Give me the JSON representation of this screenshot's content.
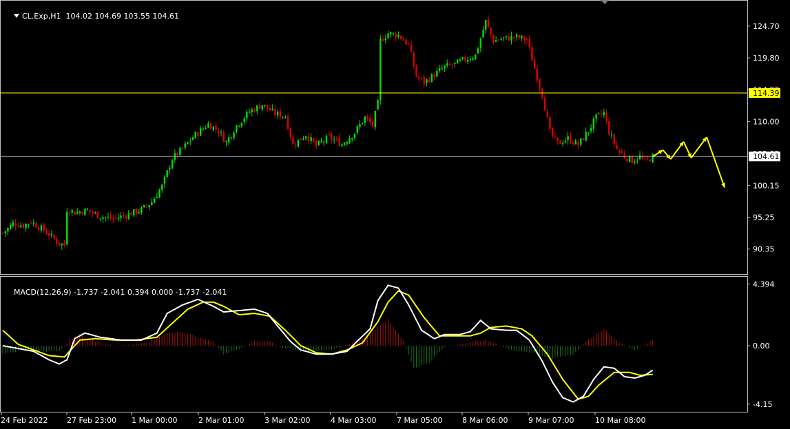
{
  "header": {
    "symbol": "CL.Exp,H1",
    "ohlc": "104.02 104.69 103.55 104.61"
  },
  "macd_header": {
    "label": "MACD(12,26,9) -1.737 -2.041 0.394 0.000 -1.737 -2.041"
  },
  "colors": {
    "background": "#000000",
    "bull": "#00e000",
    "bear": "#e00000",
    "line_yellow": "#ffff00",
    "line_white": "#ffffff",
    "hist_pos": "#b01010",
    "hist_neg": "#1f6e1f",
    "grid_line": "#808080"
  },
  "chart_data": [
    {
      "type": "candlestick",
      "symbol": "CL.Exp",
      "timeframe": "H1",
      "y_ticks": [
        "124.70",
        "119.80",
        "114.90",
        "110.00",
        "105.05",
        "100.15",
        "95.25",
        "90.35"
      ],
      "ylim": [
        86.5,
        128.5
      ],
      "horizontal_lines": [
        {
          "value": 114.39,
          "label": "114.39",
          "color": "#ffff00"
        },
        {
          "value": 104.61,
          "label": "104.61",
          "color": "#a0a0a0"
        }
      ],
      "price_anchors": [
        {
          "t": 0,
          "p": 92.8
        },
        {
          "t": 2,
          "p": 93.5
        },
        {
          "t": 4,
          "p": 94.3
        },
        {
          "t": 8,
          "p": 94.0
        },
        {
          "t": 11,
          "p": 94.6
        },
        {
          "t": 14,
          "p": 93.8
        },
        {
          "t": 18,
          "p": 92.6
        },
        {
          "t": 22,
          "p": 91.2
        },
        {
          "t": 24,
          "p": 91.0
        },
        {
          "t": 25,
          "p": 96.5
        },
        {
          "t": 28,
          "p": 96.0
        },
        {
          "t": 33,
          "p": 96.3
        },
        {
          "t": 38,
          "p": 95.4
        },
        {
          "t": 43,
          "p": 95.0
        },
        {
          "t": 48,
          "p": 95.6
        },
        {
          "t": 54,
          "p": 96.4
        },
        {
          "t": 58,
          "p": 97.6
        },
        {
          "t": 62,
          "p": 100.0
        },
        {
          "t": 66,
          "p": 104.3
        },
        {
          "t": 70,
          "p": 105.8
        },
        {
          "t": 74,
          "p": 107.6
        },
        {
          "t": 80,
          "p": 109.6
        },
        {
          "t": 84,
          "p": 108.6
        },
        {
          "t": 87,
          "p": 106.8
        },
        {
          "t": 91,
          "p": 109.4
        },
        {
          "t": 96,
          "p": 111.5
        },
        {
          "t": 101,
          "p": 112.6
        },
        {
          "t": 106,
          "p": 111.2
        },
        {
          "t": 110,
          "p": 110.8
        },
        {
          "t": 113,
          "p": 106.4
        },
        {
          "t": 118,
          "p": 108.0
        },
        {
          "t": 122,
          "p": 106.2
        },
        {
          "t": 127,
          "p": 107.6
        },
        {
          "t": 132,
          "p": 106.5
        },
        {
          "t": 137,
          "p": 108.3
        },
        {
          "t": 141,
          "p": 110.6
        },
        {
          "t": 144,
          "p": 109.4
        },
        {
          "t": 146,
          "p": 112.8
        },
        {
          "t": 147,
          "p": 122.5
        },
        {
          "t": 150,
          "p": 123.6
        },
        {
          "t": 154,
          "p": 123.3
        },
        {
          "t": 158,
          "p": 121.8
        },
        {
          "t": 161,
          "p": 117.0
        },
        {
          "t": 164,
          "p": 116.0
        },
        {
          "t": 168,
          "p": 117.2
        },
        {
          "t": 172,
          "p": 118.4
        },
        {
          "t": 176,
          "p": 118.8
        },
        {
          "t": 180,
          "p": 119.6
        },
        {
          "t": 184,
          "p": 120.2
        },
        {
          "t": 188,
          "p": 125.4
        },
        {
          "t": 191,
          "p": 122.4
        },
        {
          "t": 195,
          "p": 122.8
        },
        {
          "t": 200,
          "p": 123.0
        },
        {
          "t": 204,
          "p": 122.6
        },
        {
          "t": 207,
          "p": 118.2
        },
        {
          "t": 210,
          "p": 114.2
        },
        {
          "t": 213,
          "p": 108.3
        },
        {
          "t": 216,
          "p": 106.6
        },
        {
          "t": 220,
          "p": 107.4
        },
        {
          "t": 224,
          "p": 106.4
        },
        {
          "t": 228,
          "p": 108.6
        },
        {
          "t": 231,
          "p": 110.6
        },
        {
          "t": 234,
          "p": 111.3
        },
        {
          "t": 236,
          "p": 108.4
        },
        {
          "t": 239,
          "p": 105.8
        },
        {
          "t": 242,
          "p": 104.6
        },
        {
          "t": 245,
          "p": 104.0
        },
        {
          "t": 248,
          "p": 104.6
        },
        {
          "t": 250,
          "p": 103.8
        },
        {
          "t": 253,
          "p": 104.6
        }
      ],
      "projection": [
        {
          "t": 253,
          "p": 104.6
        },
        {
          "t": 257,
          "p": 105.6
        },
        {
          "t": 260,
          "p": 104.2
        },
        {
          "t": 265,
          "p": 106.9
        },
        {
          "t": 268,
          "p": 104.4
        },
        {
          "t": 274,
          "p": 107.6
        },
        {
          "t": 281,
          "p": 99.8
        }
      ]
    },
    {
      "type": "macd",
      "params": "12,26,9",
      "values": [
        -1.737,
        -2.041,
        0.394,
        0.0,
        -1.737,
        -2.041
      ],
      "y_ticks": [
        "4.394",
        "0.00",
        "-4.15"
      ],
      "ylim": [
        -4.7,
        4.9
      ],
      "x_ticks": [
        "24 Feb 2022",
        "27 Feb 23:00",
        "1 Mar 00:00",
        "2 Mar 01:00",
        "3 Mar 02:00",
        "4 Mar 03:00",
        "7 Mar 05:00",
        "8 Mar 06:00",
        "9 Mar 07:00",
        "10 Mar 08:00"
      ],
      "macd_line": [
        {
          "t": 0,
          "v": 0.0
        },
        {
          "t": 6,
          "v": -0.2
        },
        {
          "t": 12,
          "v": -0.4
        },
        {
          "t": 18,
          "v": -1.0
        },
        {
          "t": 22,
          "v": -1.3
        },
        {
          "t": 25,
          "v": -1.0
        },
        {
          "t": 28,
          "v": 0.5
        },
        {
          "t": 32,
          "v": 0.9
        },
        {
          "t": 38,
          "v": 0.6
        },
        {
          "t": 46,
          "v": 0.4
        },
        {
          "t": 54,
          "v": 0.4
        },
        {
          "t": 60,
          "v": 0.9
        },
        {
          "t": 64,
          "v": 2.3
        },
        {
          "t": 70,
          "v": 2.9
        },
        {
          "t": 76,
          "v": 3.3
        },
        {
          "t": 82,
          "v": 2.8
        },
        {
          "t": 86,
          "v": 2.4
        },
        {
          "t": 92,
          "v": 2.5
        },
        {
          "t": 98,
          "v": 2.6
        },
        {
          "t": 103,
          "v": 2.3
        },
        {
          "t": 107,
          "v": 1.4
        },
        {
          "t": 112,
          "v": 0.3
        },
        {
          "t": 116,
          "v": -0.3
        },
        {
          "t": 122,
          "v": -0.6
        },
        {
          "t": 128,
          "v": -0.6
        },
        {
          "t": 134,
          "v": -0.4
        },
        {
          "t": 139,
          "v": 0.5
        },
        {
          "t": 143,
          "v": 1.2
        },
        {
          "t": 146,
          "v": 3.2
        },
        {
          "t": 150,
          "v": 4.3
        },
        {
          "t": 154,
          "v": 4.1
        },
        {
          "t": 158,
          "v": 2.9
        },
        {
          "t": 163,
          "v": 1.1
        },
        {
          "t": 168,
          "v": 0.5
        },
        {
          "t": 172,
          "v": 0.8
        },
        {
          "t": 178,
          "v": 0.8
        },
        {
          "t": 182,
          "v": 1.0
        },
        {
          "t": 186,
          "v": 1.8
        },
        {
          "t": 190,
          "v": 1.2
        },
        {
          "t": 196,
          "v": 1.1
        },
        {
          "t": 200,
          "v": 1.1
        },
        {
          "t": 205,
          "v": 0.4
        },
        {
          "t": 210,
          "v": -1.1
        },
        {
          "t": 214,
          "v": -2.6
        },
        {
          "t": 218,
          "v": -3.7
        },
        {
          "t": 222,
          "v": -4.0
        },
        {
          "t": 226,
          "v": -3.6
        },
        {
          "t": 230,
          "v": -2.4
        },
        {
          "t": 234,
          "v": -1.5
        },
        {
          "t": 238,
          "v": -1.6
        },
        {
          "t": 242,
          "v": -2.2
        },
        {
          "t": 246,
          "v": -2.3
        },
        {
          "t": 250,
          "v": -2.1
        },
        {
          "t": 253,
          "v": -1.74
        }
      ],
      "signal_line": [
        {
          "t": 0,
          "v": 1.1
        },
        {
          "t": 6,
          "v": 0.1
        },
        {
          "t": 12,
          "v": -0.3
        },
        {
          "t": 18,
          "v": -0.7
        },
        {
          "t": 24,
          "v": -0.8
        },
        {
          "t": 30,
          "v": 0.4
        },
        {
          "t": 36,
          "v": 0.5
        },
        {
          "t": 44,
          "v": 0.4
        },
        {
          "t": 52,
          "v": 0.4
        },
        {
          "t": 60,
          "v": 0.6
        },
        {
          "t": 66,
          "v": 1.6
        },
        {
          "t": 72,
          "v": 2.6
        },
        {
          "t": 78,
          "v": 3.1
        },
        {
          "t": 82,
          "v": 3.1
        },
        {
          "t": 86,
          "v": 2.8
        },
        {
          "t": 92,
          "v": 2.2
        },
        {
          "t": 98,
          "v": 2.3
        },
        {
          "t": 104,
          "v": 2.1
        },
        {
          "t": 110,
          "v": 1.1
        },
        {
          "t": 116,
          "v": 0.0
        },
        {
          "t": 122,
          "v": -0.5
        },
        {
          "t": 128,
          "v": -0.6
        },
        {
          "t": 134,
          "v": -0.3
        },
        {
          "t": 140,
          "v": 0.2
        },
        {
          "t": 146,
          "v": 1.7
        },
        {
          "t": 150,
          "v": 3.1
        },
        {
          "t": 154,
          "v": 3.9
        },
        {
          "t": 158,
          "v": 3.6
        },
        {
          "t": 164,
          "v": 2.0
        },
        {
          "t": 170,
          "v": 0.7
        },
        {
          "t": 176,
          "v": 0.7
        },
        {
          "t": 182,
          "v": 0.7
        },
        {
          "t": 186,
          "v": 0.9
        },
        {
          "t": 190,
          "v": 1.3
        },
        {
          "t": 196,
          "v": 1.4
        },
        {
          "t": 202,
          "v": 1.2
        },
        {
          "t": 206,
          "v": 0.7
        },
        {
          "t": 212,
          "v": -0.6
        },
        {
          "t": 218,
          "v": -2.4
        },
        {
          "t": 224,
          "v": -3.8
        },
        {
          "t": 228,
          "v": -3.6
        },
        {
          "t": 232,
          "v": -2.8
        },
        {
          "t": 238,
          "v": -1.9
        },
        {
          "t": 244,
          "v": -1.9
        },
        {
          "t": 248,
          "v": -2.1
        },
        {
          "t": 253,
          "v": -2.04
        }
      ],
      "histogram": [
        {
          "t": 0,
          "v": -0.6
        },
        {
          "t": 8,
          "v": -0.3
        },
        {
          "t": 16,
          "v": -0.4
        },
        {
          "t": 22,
          "v": -0.4
        },
        {
          "t": 26,
          "v": 0.4
        },
        {
          "t": 30,
          "v": 0.8
        },
        {
          "t": 36,
          "v": 0.3
        },
        {
          "t": 44,
          "v": 0.0
        },
        {
          "t": 56,
          "v": 0.2
        },
        {
          "t": 64,
          "v": 0.9
        },
        {
          "t": 70,
          "v": 1.0
        },
        {
          "t": 76,
          "v": 0.6
        },
        {
          "t": 82,
          "v": 0.3
        },
        {
          "t": 86,
          "v": -0.6
        },
        {
          "t": 92,
          "v": -0.2
        },
        {
          "t": 98,
          "v": 0.3
        },
        {
          "t": 104,
          "v": 0.3
        },
        {
          "t": 108,
          "v": -0.1
        },
        {
          "t": 116,
          "v": -0.4
        },
        {
          "t": 124,
          "v": -0.4
        },
        {
          "t": 132,
          "v": -0.1
        },
        {
          "t": 140,
          "v": 0.5
        },
        {
          "t": 146,
          "v": 1.3
        },
        {
          "t": 150,
          "v": 1.9
        },
        {
          "t": 156,
          "v": 0.3
        },
        {
          "t": 160,
          "v": -1.6
        },
        {
          "t": 166,
          "v": -1.2
        },
        {
          "t": 172,
          "v": -0.1
        },
        {
          "t": 180,
          "v": 0.2
        },
        {
          "t": 188,
          "v": 0.4
        },
        {
          "t": 198,
          "v": -0.3
        },
        {
          "t": 206,
          "v": -0.5
        },
        {
          "t": 214,
          "v": -0.9
        },
        {
          "t": 222,
          "v": -0.6
        },
        {
          "t": 228,
          "v": 0.4
        },
        {
          "t": 234,
          "v": 1.2
        },
        {
          "t": 240,
          "v": 0.2
        },
        {
          "t": 246,
          "v": -0.3
        },
        {
          "t": 253,
          "v": 0.39
        }
      ]
    }
  ]
}
